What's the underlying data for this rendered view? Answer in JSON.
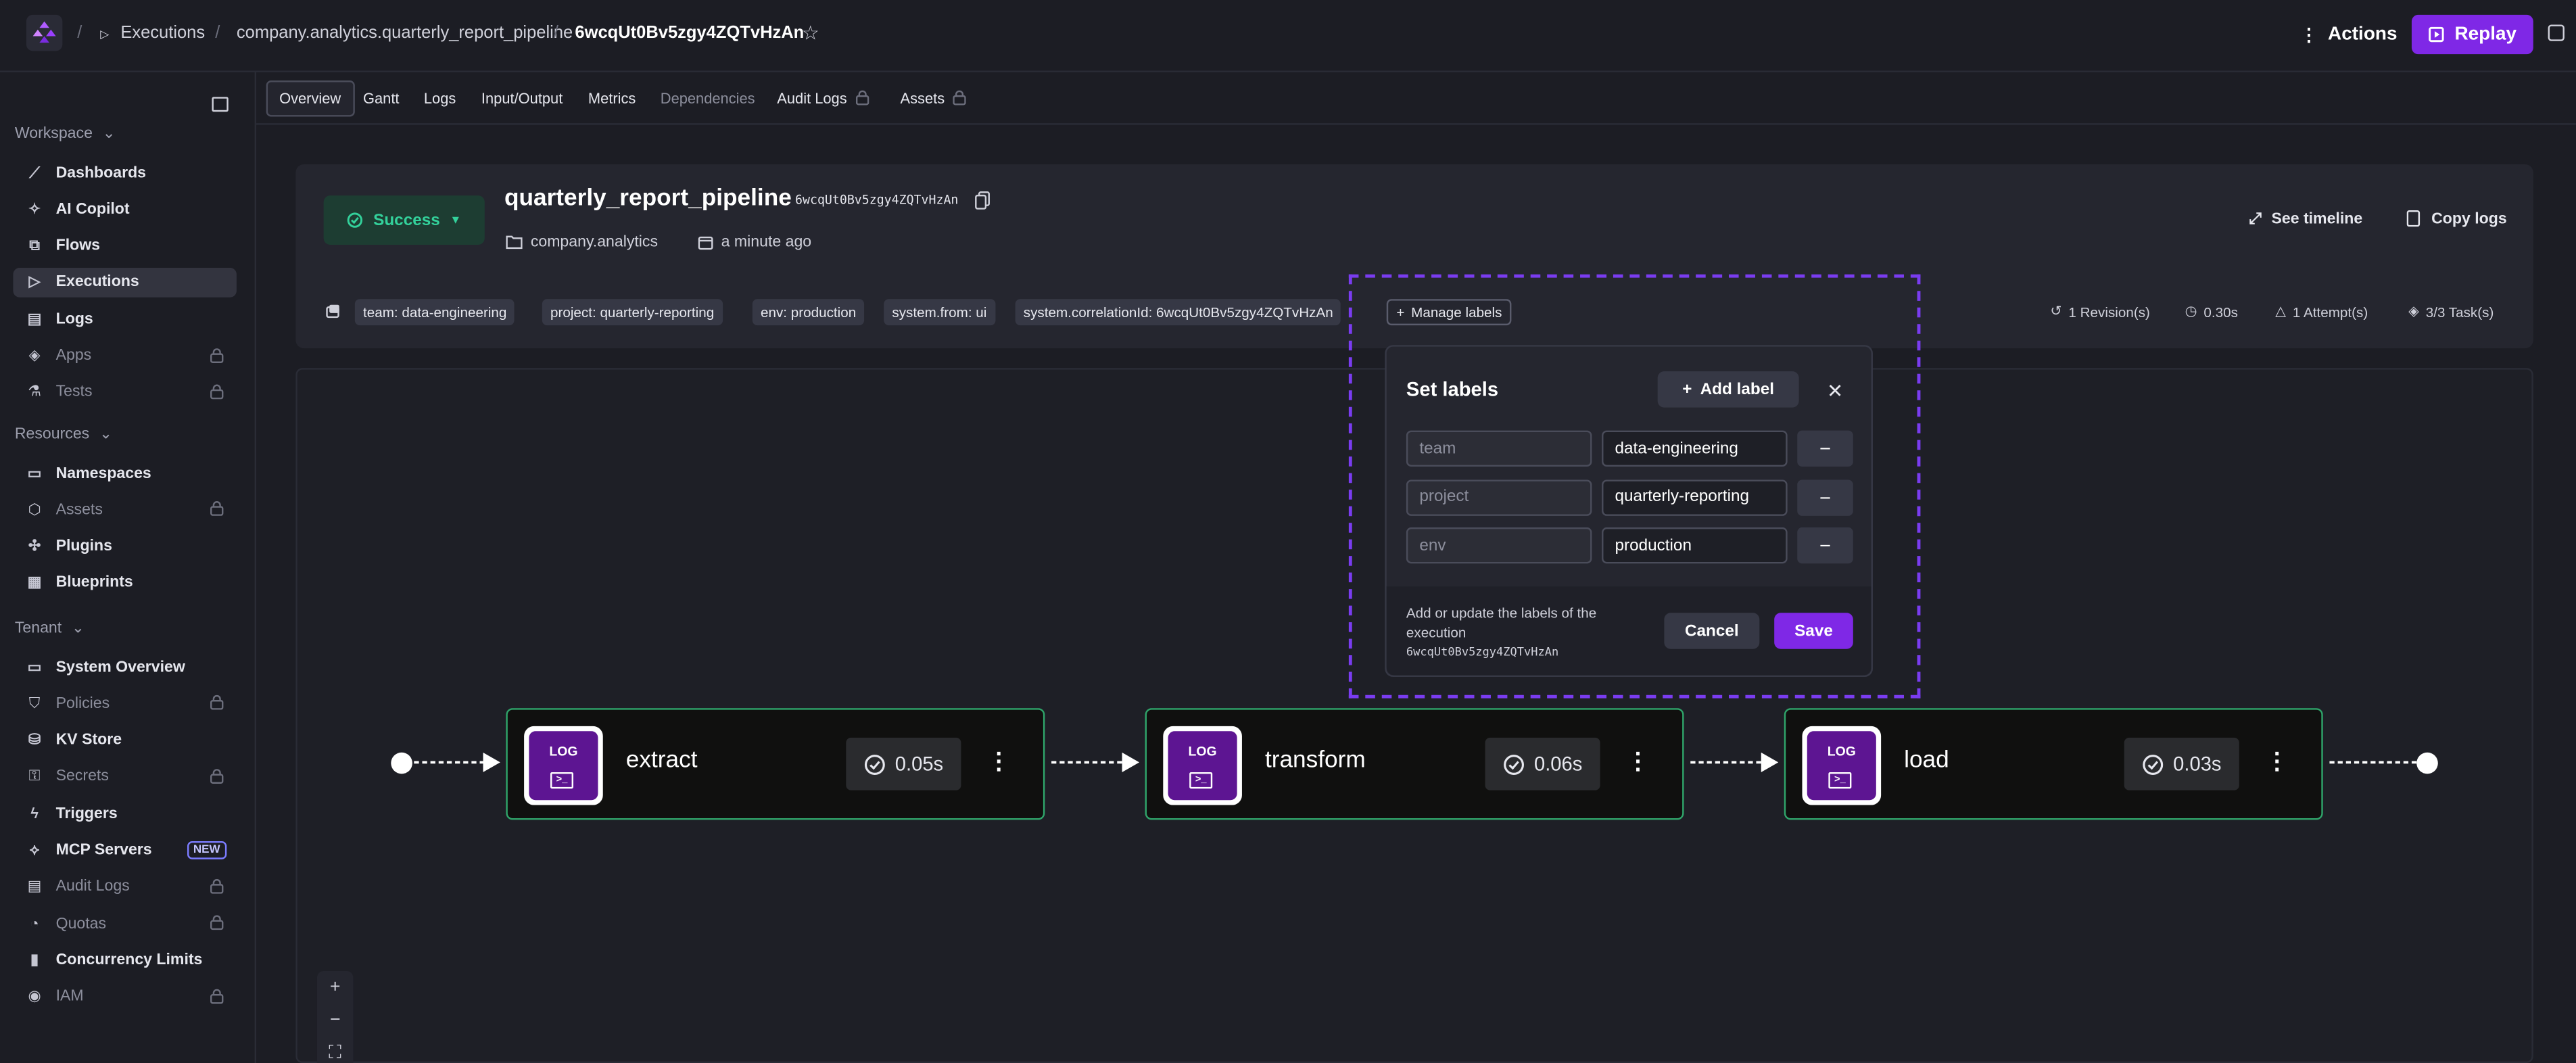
{
  "breadcrumb": {
    "executions": "Executions",
    "namespace_flow": "company.analytics.quarterly_report_pipeline",
    "execution_id": "6wcqUt0Bv5zgy4ZQTvHzAn"
  },
  "header": {
    "actions_label": "Actions",
    "replay_label": "Replay"
  },
  "sidebar": {
    "sections": [
      {
        "title": "Workspace",
        "items": [
          {
            "label": "Dashboards",
            "icon": "chart-line-icon",
            "locked": false
          },
          {
            "label": "AI Copilot",
            "icon": "wand-icon",
            "locked": false
          },
          {
            "label": "Flows",
            "icon": "flow-icon",
            "locked": false
          },
          {
            "label": "Executions",
            "icon": "play-icon",
            "locked": false,
            "active": true
          },
          {
            "label": "Logs",
            "icon": "document-icon",
            "locked": false
          },
          {
            "label": "Apps",
            "icon": "layers-icon",
            "locked": true
          },
          {
            "label": "Tests",
            "icon": "flask-icon",
            "locked": true
          }
        ]
      },
      {
        "title": "Resources",
        "items": [
          {
            "label": "Namespaces",
            "icon": "folders-icon",
            "locked": false
          },
          {
            "label": "Assets",
            "icon": "cube-icon",
            "locked": true
          },
          {
            "label": "Plugins",
            "icon": "puzzle-icon",
            "locked": false
          },
          {
            "label": "Blueprints",
            "icon": "grid-icon",
            "locked": false
          }
        ]
      },
      {
        "title": "Tenant",
        "items": [
          {
            "label": "System Overview",
            "icon": "monitor-icon",
            "locked": false
          },
          {
            "label": "Policies",
            "icon": "shield-icon",
            "locked": true
          },
          {
            "label": "KV Store",
            "icon": "database-icon",
            "locked": false
          },
          {
            "label": "Secrets",
            "icon": "key-icon",
            "locked": true
          },
          {
            "label": "Triggers",
            "icon": "lightning-icon",
            "locked": false
          },
          {
            "label": "MCP Servers",
            "icon": "mcp-icon",
            "locked": false,
            "badge": "NEW"
          },
          {
            "label": "Audit Logs",
            "icon": "file-icon",
            "locked": true
          },
          {
            "label": "Quotas",
            "icon": "gauge-icon",
            "locked": true
          },
          {
            "label": "Concurrency Limits",
            "icon": "lock-icon",
            "locked": false
          },
          {
            "label": "IAM",
            "icon": "user-shield-icon",
            "locked": true
          }
        ]
      }
    ]
  },
  "tabs": [
    {
      "label": "Overview",
      "active": true,
      "dim": false,
      "locked": false
    },
    {
      "label": "Gantt",
      "active": false,
      "dim": false,
      "locked": false
    },
    {
      "label": "Logs",
      "active": false,
      "dim": false,
      "locked": false
    },
    {
      "label": "Input/Output",
      "active": false,
      "dim": false,
      "locked": false
    },
    {
      "label": "Metrics",
      "active": false,
      "dim": false,
      "locked": false
    },
    {
      "label": "Dependencies",
      "active": false,
      "dim": true,
      "locked": false
    },
    {
      "label": "Audit Logs",
      "active": false,
      "dim": false,
      "locked": true
    },
    {
      "label": "Assets",
      "active": false,
      "dim": false,
      "locked": true
    }
  ],
  "execution": {
    "status": "Success",
    "flow_name": "quarterly_report_pipeline",
    "execution_id": "6wcqUt0Bv5zgy4ZQTvHzAn",
    "namespace": "company.analytics",
    "started": "a minute ago",
    "see_timeline": "See timeline",
    "copy_logs": "Copy logs"
  },
  "labels": [
    "team: data-engineering",
    "project: quarterly-reporting",
    "env: production",
    "system.from: ui",
    "system.correlationId: 6wcqUt0Bv5zgy4ZQTvHzAn"
  ],
  "manage_labels": "Manage labels",
  "stats": {
    "revisions": "1 Revision(s)",
    "duration": "0.30s",
    "attempts": "1 Attempt(s)",
    "tasks": "3/3 Task(s)"
  },
  "set_labels": {
    "title": "Set labels",
    "add_label": "Add label",
    "rows": [
      {
        "key": "team",
        "value": "data-engineering"
      },
      {
        "key": "project",
        "value": "quarterly-reporting"
      },
      {
        "key": "env",
        "value": "production"
      }
    ],
    "description": "Add or update the labels of the execution",
    "description_id": "6wcqUt0Bv5zgy4ZQTvHzAn",
    "cancel": "Cancel",
    "save": "Save"
  },
  "nodes": [
    {
      "name": "extract",
      "duration": "0.05s",
      "icon_text": "LOG"
    },
    {
      "name": "transform",
      "duration": "0.06s",
      "icon_text": "LOG"
    },
    {
      "name": "load",
      "duration": "0.03s",
      "icon_text": "LOG"
    }
  ],
  "zoom": {
    "in": "+",
    "out": "−"
  },
  "colors": {
    "accent": "#7f28e6",
    "success": "#33d19b",
    "node_border": "#2fa46a",
    "focus_outline": "#7a3cf0"
  }
}
